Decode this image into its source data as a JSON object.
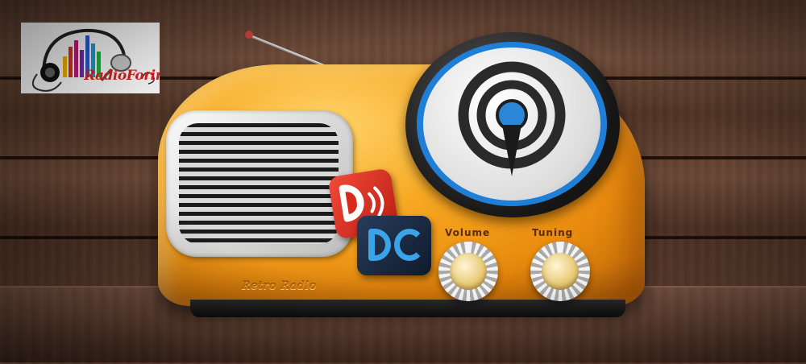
{
  "logo": {
    "text": "RadioForing"
  },
  "radio": {
    "brand": "Retro Radio",
    "knobs": {
      "volume_label": "Volume",
      "tuning_label": "Tuning"
    }
  },
  "apps": [
    {
      "name": "red-d-app-icon",
      "letter": "D"
    },
    {
      "name": "dc-app-icon",
      "letters": "DC"
    }
  ],
  "colors": {
    "radio_body": "#f7a822",
    "dial_ring": "#1f7fd6",
    "logo_text": "#d9261c",
    "wood": "#5a3b2c"
  }
}
